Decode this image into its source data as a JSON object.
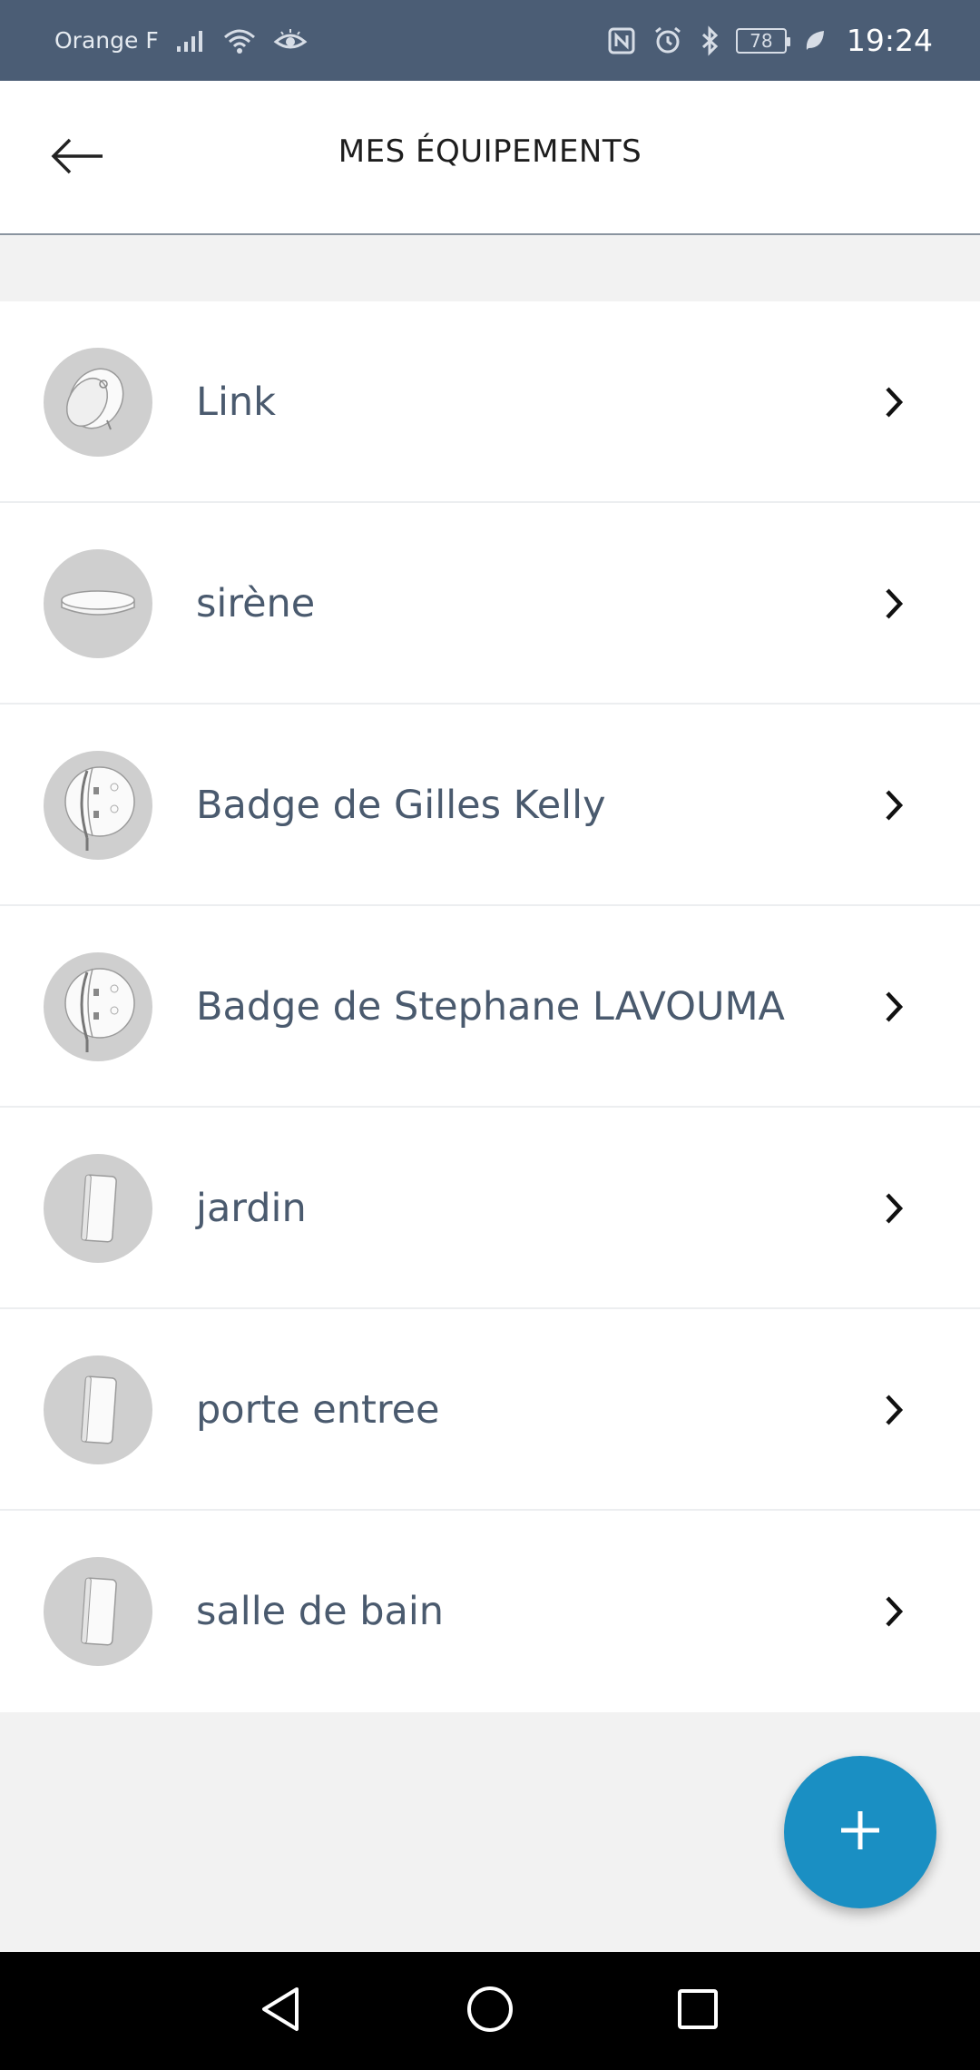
{
  "status_bar": {
    "carrier": "Orange F",
    "battery_level": "78",
    "time": "19:24",
    "icons": [
      "signal-icon",
      "wifi-icon",
      "eye-comfort-icon",
      "nfc-icon",
      "alarm-icon",
      "bluetooth-icon",
      "battery-icon",
      "leaf-icon"
    ]
  },
  "header": {
    "title": "MES ÉQUIPEMENTS",
    "back_icon": "arrow-left-icon"
  },
  "devices": [
    {
      "name": "Link",
      "icon": "link-device-icon"
    },
    {
      "name": "sirène",
      "icon": "siren-device-icon"
    },
    {
      "name": "Badge de Gilles Kelly",
      "icon": "badge-device-icon"
    },
    {
      "name": "Badge de Stephane LAVOUMA",
      "icon": "badge-device-icon"
    },
    {
      "name": "jardin",
      "icon": "door-sensor-icon"
    },
    {
      "name": "porte entree",
      "icon": "door-sensor-icon"
    },
    {
      "name": "salle de bain",
      "icon": "door-sensor-icon"
    }
  ],
  "fab": {
    "icon": "plus-icon"
  },
  "nav_bar": {
    "icons": [
      "back-triangle-icon",
      "home-circle-icon",
      "recents-square-icon"
    ]
  },
  "colors": {
    "status_bar": "#4b5d75",
    "accent": "#1a8fc3",
    "text": "#4a5a6e",
    "avatar_bg": "#cfcfcf",
    "background": "#f2f2f2"
  }
}
